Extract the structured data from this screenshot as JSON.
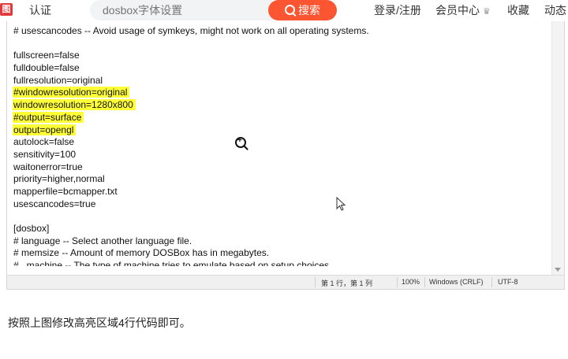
{
  "nav": {
    "logo_text": "图",
    "auth_label": "认证",
    "search_placeholder": "dosbox字体设置",
    "search_button_label": "搜索",
    "login_label": "登录/注册",
    "member_label": "会员中心",
    "favorites_label": "收藏",
    "dynamic_label": "动态"
  },
  "editor": {
    "lines": [
      {
        "text": "# usescancodes -- Avoid usage of symkeys, might not work on all operating systems.",
        "highlighted": false
      },
      {
        "text": "",
        "highlighted": false
      },
      {
        "text": "fullscreen=false",
        "highlighted": false
      },
      {
        "text": "fulldouble=false",
        "highlighted": false
      },
      {
        "text": "fullresolution=original",
        "highlighted": false
      },
      {
        "text": "#windowresolution=original",
        "highlighted": true
      },
      {
        "text": "windowresolution=1280x800",
        "highlighted": true
      },
      {
        "text": "#output=surface",
        "highlighted": true
      },
      {
        "text": "output=opengl",
        "highlighted": true
      },
      {
        "text": "autolock=false",
        "highlighted": false
      },
      {
        "text": "sensitivity=100",
        "highlighted": false
      },
      {
        "text": "waitonerror=true",
        "highlighted": false
      },
      {
        "text": "priority=higher,normal",
        "highlighted": false
      },
      {
        "text": "mapperfile=bcmapper.txt",
        "highlighted": false
      },
      {
        "text": "usescancodes=true",
        "highlighted": false
      },
      {
        "text": "",
        "highlighted": false
      },
      {
        "text": "[dosbox]",
        "highlighted": false
      },
      {
        "text": "# language -- Select another language file.",
        "highlighted": false
      },
      {
        "text": "# memsize -- Amount of memory DOSBox has in megabytes.",
        "highlighted": false
      },
      {
        "text": "#   machine -- The type of machine tries to emulate based on setup choices.",
        "highlighted": false
      }
    ],
    "status": {
      "position": "第 1 行，第 1 列",
      "zoom": "100%",
      "line_ending": "Windows (CRLF)",
      "encoding": "UTF-8"
    }
  },
  "caption": "按照上图修改高亮区域4行代码即可。",
  "colors": {
    "highlight": "#ffff37",
    "search_button": "#fc5531",
    "logo": "#e4393c"
  }
}
